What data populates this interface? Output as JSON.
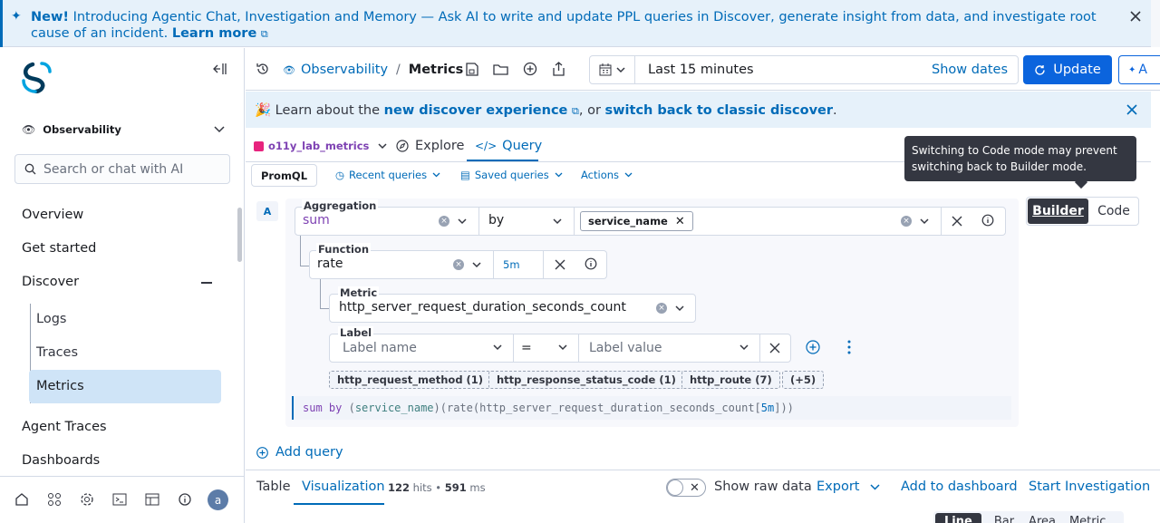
{
  "announcement": {
    "new_label": "New!",
    "text": " Introducing Agentic Chat, Investigation and Memory — Ask AI to write and update PPL queries in Discover, generate insight from data, and investigate root cause of an incident. ",
    "link": "Learn more"
  },
  "sidebar": {
    "workspace": "Observability",
    "search_placeholder": "Search or chat with AI",
    "items": [
      {
        "label": "Overview"
      },
      {
        "label": "Get started"
      },
      {
        "label": "Discover"
      },
      {
        "label": "Agent Traces"
      },
      {
        "label": "Dashboards"
      }
    ],
    "sub_items": [
      {
        "label": "Logs"
      },
      {
        "label": "Traces"
      },
      {
        "label": "Metrics",
        "active": true
      }
    ],
    "avatar_letter": "a"
  },
  "header": {
    "breadcrumb_app": "Observability",
    "breadcrumb_sep": "/",
    "breadcrumb_page": "Metrics",
    "time_range": "Last 15 minutes",
    "show_dates": "Show dates",
    "update": "Update",
    "ai_label": "A"
  },
  "discover_banner": {
    "prefix": "🎉 Learn about the ",
    "link1": "new discover experience",
    "mid": ", or ",
    "link2": "switch back to classic discover",
    "suffix": "."
  },
  "tabs": {
    "dataset": "o11y_lab_metrics",
    "explore": "Explore",
    "query": "Query"
  },
  "toolbar": {
    "language": "PromQL",
    "recent": "Recent queries",
    "saved": "Saved queries",
    "actions": "Actions"
  },
  "tooltip": "Switching to Code mode may prevent switching back to Builder mode.",
  "mode": {
    "builder": "Builder",
    "code": "Code"
  },
  "query": {
    "letter": "A",
    "aggregation_label": "Aggregation",
    "aggregation_value": "sum",
    "by_value": "by",
    "group_label": "service_name",
    "function_label": "Function",
    "function_value": "rate",
    "range_value": "5m",
    "metric_label": "Metric",
    "metric_value": "http_server_request_duration_seconds_count",
    "label_label": "Label",
    "label_name_placeholder": "Label name",
    "operator": "=",
    "label_value_placeholder": "Label value",
    "suggestions": [
      {
        "label": "http_request_method (1)"
      },
      {
        "label": "http_response_status_code (1)"
      },
      {
        "label": "http_route (7)"
      },
      {
        "label": "(+5)"
      }
    ],
    "preview": {
      "t1": "sum",
      "t2": " by ",
      "t3": "(",
      "t4": "service_name",
      "t5": ")(rate(http_server_request_duration_seconds_count[",
      "t6": "5m",
      "t7": "]))"
    },
    "add_query": "Add query"
  },
  "results": {
    "tab_table": "Table",
    "tab_viz": "Visualization",
    "hits_count": "122",
    "hits_label": " hits • ",
    "ms_count": "591",
    "ms_label": " ms",
    "raw_data": "Show raw data",
    "export": "Export",
    "add_dashboard": "Add to dashboard",
    "investigation": "Start Investigation",
    "chart_types": [
      {
        "label": "Line"
      },
      {
        "label": "Bar"
      },
      {
        "label": "Area"
      },
      {
        "label": "Metric"
      }
    ]
  },
  "colors": {
    "primary": "#006bb8",
    "update": "#0b64dd",
    "purple": "#7e42b3",
    "teal": "#3f7f7f"
  }
}
